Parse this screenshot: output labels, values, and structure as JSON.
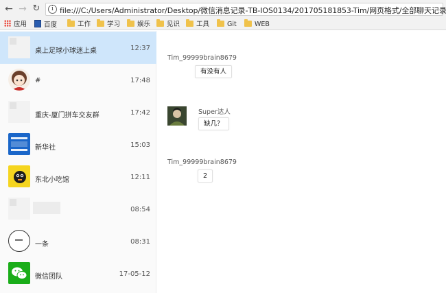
{
  "browser": {
    "url": "file:///C:/Users/Administrator/Desktop/微信消息记录-TB-IOS0134/201705181853-Tim/网页格式/全部聊天记录.html",
    "bookmarks": [
      {
        "label": "应用",
        "icon": "apps-icon"
      },
      {
        "label": "百度",
        "icon": "page-icon"
      },
      {
        "label": "工作",
        "icon": "folder-icon"
      },
      {
        "label": "学习",
        "icon": "folder-icon"
      },
      {
        "label": "娱乐",
        "icon": "folder-icon"
      },
      {
        "label": "见识",
        "icon": "folder-icon"
      },
      {
        "label": "工具",
        "icon": "folder-icon"
      },
      {
        "label": "Git",
        "icon": "folder-icon"
      },
      {
        "label": "WEB",
        "icon": "folder-icon"
      }
    ]
  },
  "conversations": [
    {
      "name": "桌上足球小球迷上桌",
      "time": "12:37",
      "active": true
    },
    {
      "name": "#",
      "time": "17:48"
    },
    {
      "name": "重庆-厦门拼车交友群",
      "time": "17:42"
    },
    {
      "name": "新华社",
      "time": "15:03"
    },
    {
      "name": "东北小吃馆",
      "time": "12:11"
    },
    {
      "name": "",
      "time": "08:54"
    },
    {
      "name": "一条",
      "time": "08:31"
    },
    {
      "name": "微信团队",
      "time": "17-05-12"
    }
  ],
  "messages": [
    {
      "sender": "Tim_99999brain8679",
      "text": "有没有人"
    },
    {
      "sender": "Super达人",
      "text": "缺几？"
    },
    {
      "sender": "Tim_99999brain8679",
      "text": "2"
    }
  ],
  "colors": {
    "active_row": "#cfe6fb",
    "wechat_green": "#1aad19"
  }
}
